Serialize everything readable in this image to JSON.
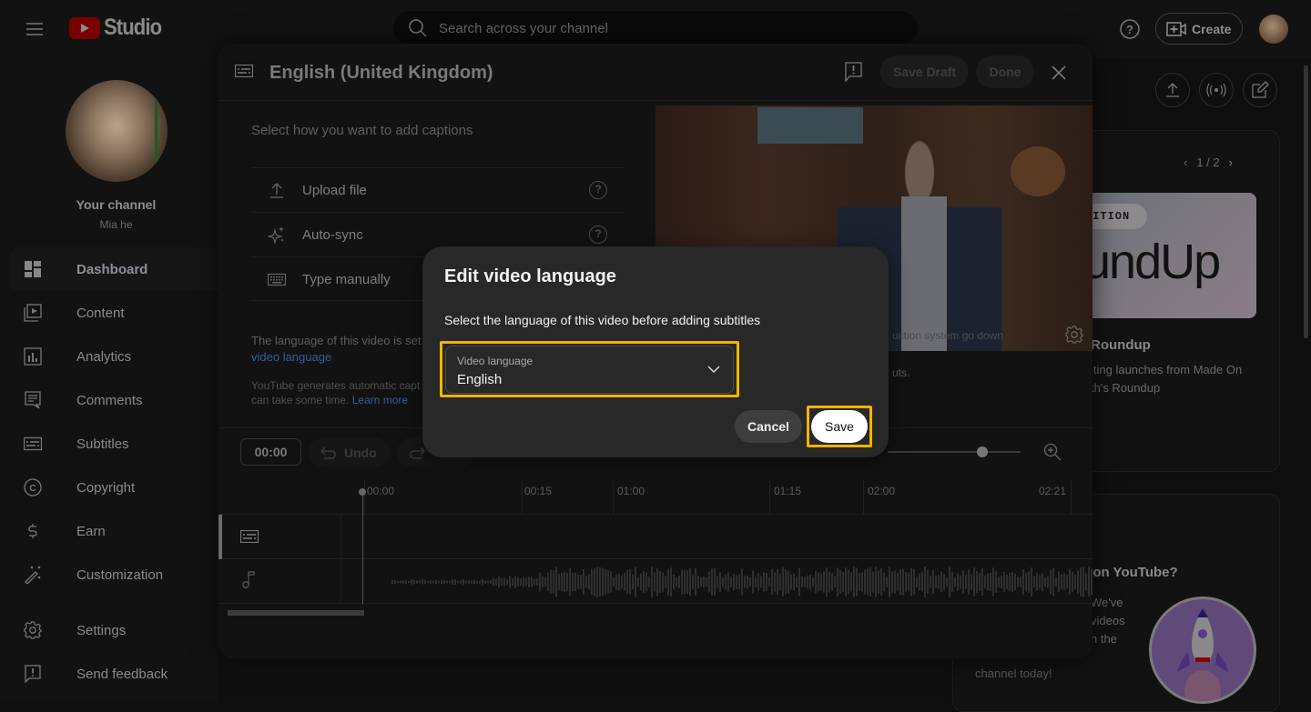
{
  "topbar": {
    "app_name": "Studio",
    "search_placeholder": "Search across your channel",
    "create_label": "Create"
  },
  "sidebar": {
    "channel_title": "Your channel",
    "channel_name": "Mia he",
    "items": [
      {
        "label": "Dashboard",
        "icon": "dashboard-icon",
        "active": true
      },
      {
        "label": "Content",
        "icon": "content-icon"
      },
      {
        "label": "Analytics",
        "icon": "analytics-icon"
      },
      {
        "label": "Comments",
        "icon": "comments-icon"
      },
      {
        "label": "Subtitles",
        "icon": "subtitles-icon"
      },
      {
        "label": "Copyright",
        "icon": "copyright-icon"
      },
      {
        "label": "Earn",
        "icon": "dollar-icon"
      },
      {
        "label": "Customization",
        "icon": "magic-wand-icon"
      },
      {
        "label": "Settings",
        "icon": "gear-icon"
      },
      {
        "label": "Send feedback",
        "icon": "feedback-icon"
      }
    ]
  },
  "dashboard": {
    "news": {
      "pager": "1 / 2",
      "thumb_badge": "DITION",
      "thumb_text": "undUp",
      "title": "Roundup",
      "description": "iting launches from Made On\nth's Roundup"
    },
    "help": {
      "title": "l on YouTube?",
      "description": "We've\nvideos\nn the",
      "description_tail": "channel today!"
    }
  },
  "editor": {
    "title": "English (United Kingdom)",
    "save_draft_label": "Save Draft",
    "done_label": "Done",
    "caption_prompt": "Select how you want to add captions",
    "options": [
      {
        "label": "Upload file",
        "icon": "upload-icon",
        "help": true
      },
      {
        "label": "Auto-sync",
        "icon": "sparkle-icon",
        "help": true
      },
      {
        "label": "Type manually",
        "icon": "keyboard-icon",
        "help": false
      }
    ],
    "language_note": "The language of this video is set",
    "language_link": "video language",
    "auto_note": "YouTube generates automatic capt",
    "auto_note2": "can take some time.",
    "learn_more": "Learn more",
    "video_caption": "uction system go down",
    "video_text": "uts.",
    "timecode": "00:00",
    "undo_label": "Undo",
    "zoom_level": 0.71,
    "timeline_ticks": [
      "00:00",
      "00:15",
      "01:00",
      "01:15",
      "02:00",
      "02:21"
    ]
  },
  "dialog": {
    "title": "Edit video language",
    "subtitle": "Select the language of this video before adding subtitles",
    "field_label": "Video language",
    "field_value": "English",
    "cancel_label": "Cancel",
    "save_label": "Save",
    "highlight_color": "#f5b400"
  }
}
